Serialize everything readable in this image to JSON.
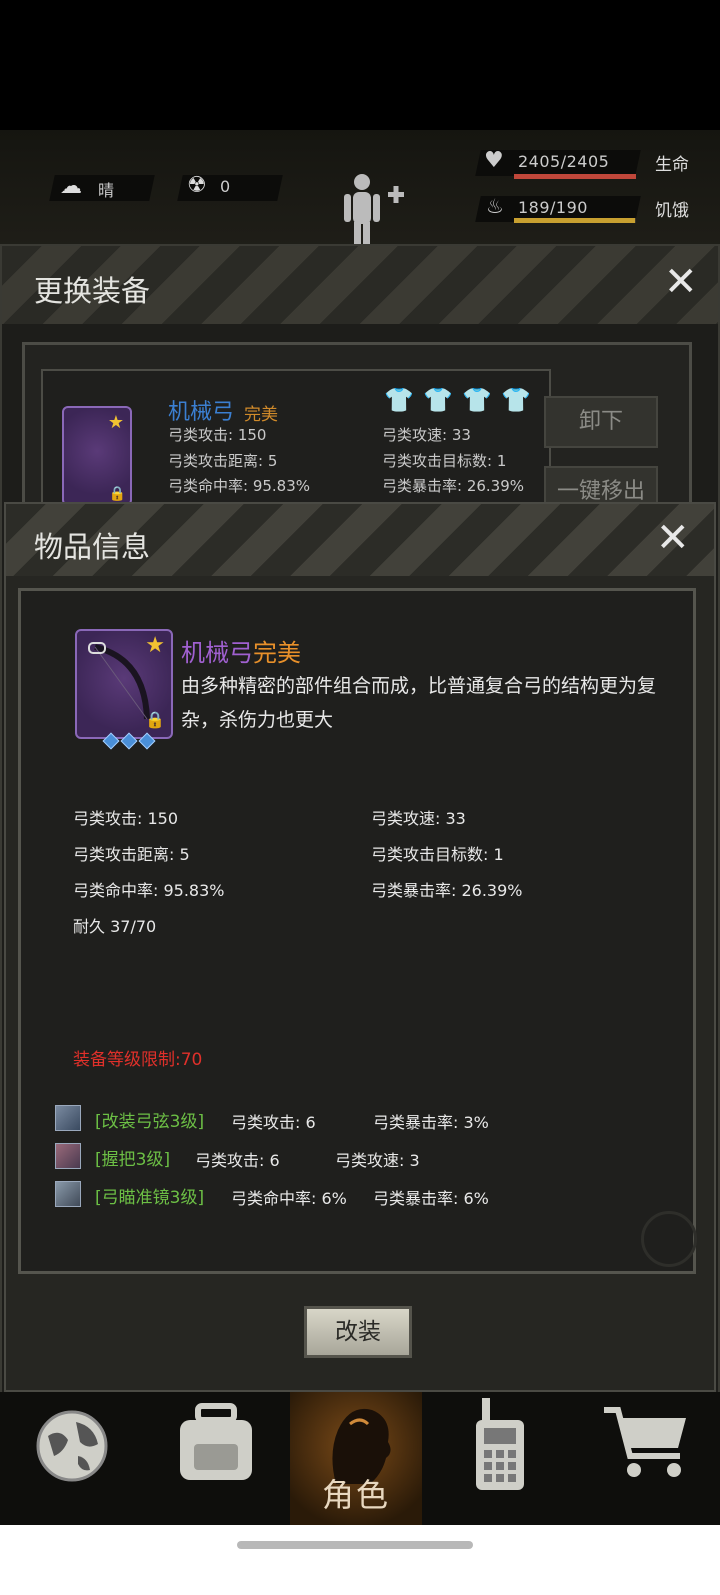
{
  "status": {
    "weather": {
      "label": "晴",
      "icon": "cloud-sun-icon"
    },
    "radiation": {
      "value": "0",
      "icon": "radiation-icon"
    },
    "health": {
      "value": "2405/2405",
      "label": "生命",
      "fraction": 1.0,
      "color": "#c0473a"
    },
    "hunger": {
      "value": "189/190",
      "label": "饥饿",
      "fraction": 0.995,
      "color": "#c8a030"
    }
  },
  "equip_panel": {
    "title": "更换装备",
    "item": {
      "name": "机械弓",
      "quality": "完美",
      "stats_left": [
        "弓类攻击: 150",
        "弓类攻击距离: 5",
        "弓类命中率: 95.83%"
      ],
      "stats_right": [
        "弓类攻速: 33",
        "弓类攻击目标数: 1",
        "弓类暴击率: 26.39%"
      ]
    },
    "unequip_label": "卸下",
    "remove_all_label": "一键移出"
  },
  "info_panel": {
    "title": "物品信息",
    "item": {
      "name": "机械弓",
      "quality": "完美",
      "description": "由多种精密的部件组合而成，比普通复合弓的结构更为复杂，杀伤力也更大"
    },
    "stats": [
      [
        "弓类攻击: 150",
        "弓类攻速: 33"
      ],
      [
        "弓类攻击距离: 5",
        "弓类攻击目标数: 1"
      ],
      [
        "弓类命中率: 95.83%",
        "弓类暴击率: 26.39%"
      ]
    ],
    "durability": "耐久 37/70",
    "level_requirement": "装备等级限制:70",
    "mods": [
      {
        "name": "[改装弓弦3级]",
        "effects": [
          "弓类攻击: 6",
          "弓类暴击率: 3%"
        ]
      },
      {
        "name": "[握把3级]",
        "effects": [
          "弓类攻击: 6",
          "弓类攻速: 3"
        ]
      },
      {
        "name": "[弓瞄准镜3级]",
        "effects": [
          "弓类命中率: 6%",
          "弓类暴击率: 6%"
        ]
      }
    ],
    "modify_button": "改装"
  },
  "bottom_nav": {
    "items": [
      {
        "icon": "globe-icon"
      },
      {
        "icon": "backpack-icon"
      },
      {
        "icon": "character-head-icon",
        "label": "角色"
      },
      {
        "icon": "walkie-talkie-icon"
      },
      {
        "icon": "shopping-cart-icon"
      }
    ]
  }
}
